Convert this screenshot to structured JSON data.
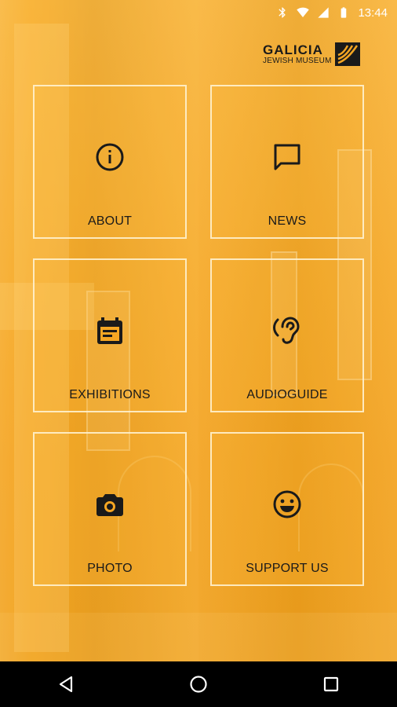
{
  "status_bar": {
    "time": "13:44",
    "icons": [
      "bluetooth-icon",
      "wifi-icon",
      "cell-signal-icon",
      "battery-icon"
    ]
  },
  "logo": {
    "line1": "GALICIA",
    "line2": "JEWISH MUSEUM"
  },
  "menu": {
    "tiles": [
      {
        "label": "ABOUT",
        "icon": "info-icon"
      },
      {
        "label": "NEWS",
        "icon": "chat-bubble-icon"
      },
      {
        "label": "EXHIBITIONS",
        "icon": "calendar-icon"
      },
      {
        "label": "AUDIOGUIDE",
        "icon": "hearing-icon"
      },
      {
        "label": "PHOTO",
        "icon": "camera-icon"
      },
      {
        "label": "SUPPORT US",
        "icon": "smiley-icon"
      }
    ]
  },
  "nav_bar": {
    "buttons": [
      "back-icon",
      "home-icon",
      "recents-icon"
    ]
  },
  "colors": {
    "accent": "#F5A623",
    "icon": "#1A1A1A",
    "tile_border": "#FFF5D7"
  }
}
